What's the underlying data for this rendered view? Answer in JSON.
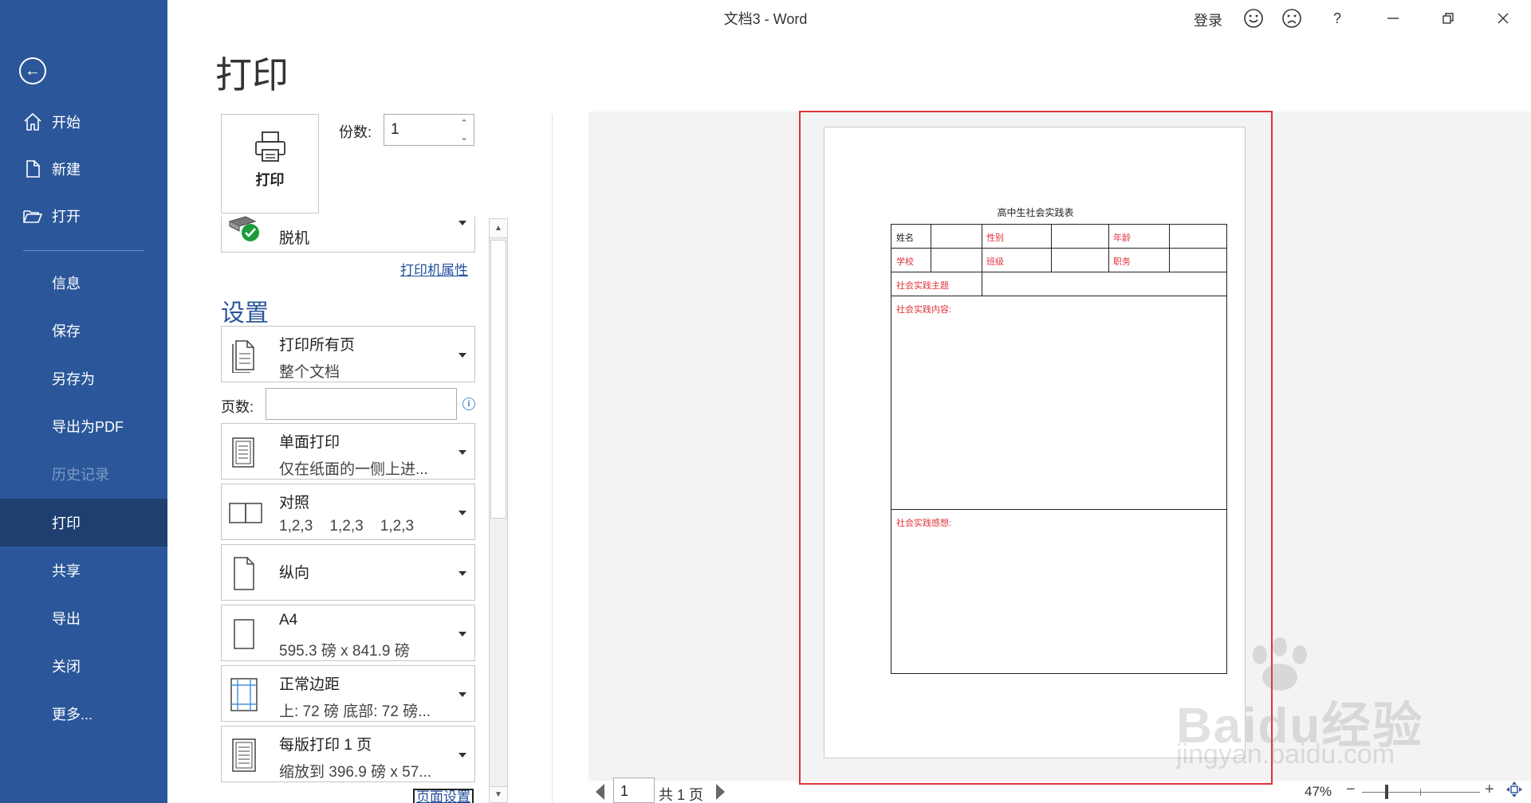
{
  "window": {
    "title": "文档3 - Word",
    "login": "登录",
    "help": "?"
  },
  "sidebar": {
    "items": [
      {
        "label": "开始"
      },
      {
        "label": "新建"
      },
      {
        "label": "打开"
      },
      {
        "label": "信息"
      },
      {
        "label": "保存"
      },
      {
        "label": "另存为"
      },
      {
        "label": "导出为PDF"
      },
      {
        "label": "历史记录"
      },
      {
        "label": "打印"
      },
      {
        "label": "共享"
      },
      {
        "label": "导出"
      },
      {
        "label": "关闭"
      },
      {
        "label": "更多..."
      }
    ]
  },
  "print": {
    "title": "打印",
    "print_button": "打印",
    "copies_label": "份数:",
    "copies_value": "1",
    "printer_name": "脱机",
    "printer_properties": "打印机属性",
    "settings_heading": "设置",
    "pages_label": "页数:",
    "pages_value": "",
    "options": [
      {
        "line1": "打印所有页",
        "line2": "整个文档"
      },
      {
        "line1": "单面打印",
        "line2": "仅在纸面的一侧上进..."
      },
      {
        "line1": "对照",
        "line2": "1,2,3    1,2,3    1,2,3"
      },
      {
        "line1": "纵向",
        "line2": ""
      },
      {
        "line1": "A4",
        "line2": "595.3 磅 x 841.9 磅"
      },
      {
        "line1": "正常边距",
        "line2": "上: 72 磅 底部: 72 磅..."
      },
      {
        "line1": "每版打印 1 页",
        "line2": "缩放到 396.9 磅 x 57..."
      }
    ],
    "page_setup": "页面设置"
  },
  "preview": {
    "doc_title": "高中生社会实践表",
    "row1": [
      "姓名",
      "性别",
      "年龄"
    ],
    "row2": [
      "学校",
      "班级",
      "职务"
    ],
    "row3": "社会实践主题",
    "content_label": "社会实践内容:",
    "thoughts_label": "社会实践感想:"
  },
  "nav": {
    "current_page": "1",
    "total": "共 1 页",
    "zoom": "47%",
    "zoom_minus": "−",
    "zoom_plus": "+"
  },
  "colors": {
    "sidebar": "#2b579a",
    "sidebar_active": "#1e3f70",
    "highlight": "#e0323b",
    "red_text": "#e0323b"
  },
  "watermark": {
    "main": "Baidu经验",
    "sub": "jingyan.baidu.com"
  }
}
